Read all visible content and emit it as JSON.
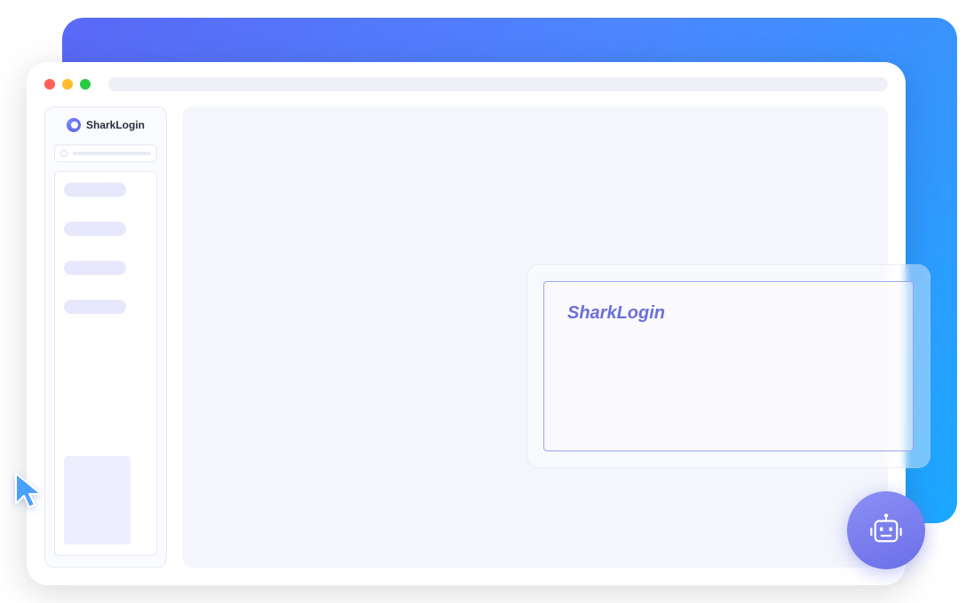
{
  "sidebar": {
    "title": "SharkLogin"
  },
  "floating_panel": {
    "title": "SharkLogin"
  },
  "colors": {
    "accent": "#6b6fd8",
    "gradient_start": "#5a68f5",
    "gradient_end": "#1ba8ff"
  }
}
